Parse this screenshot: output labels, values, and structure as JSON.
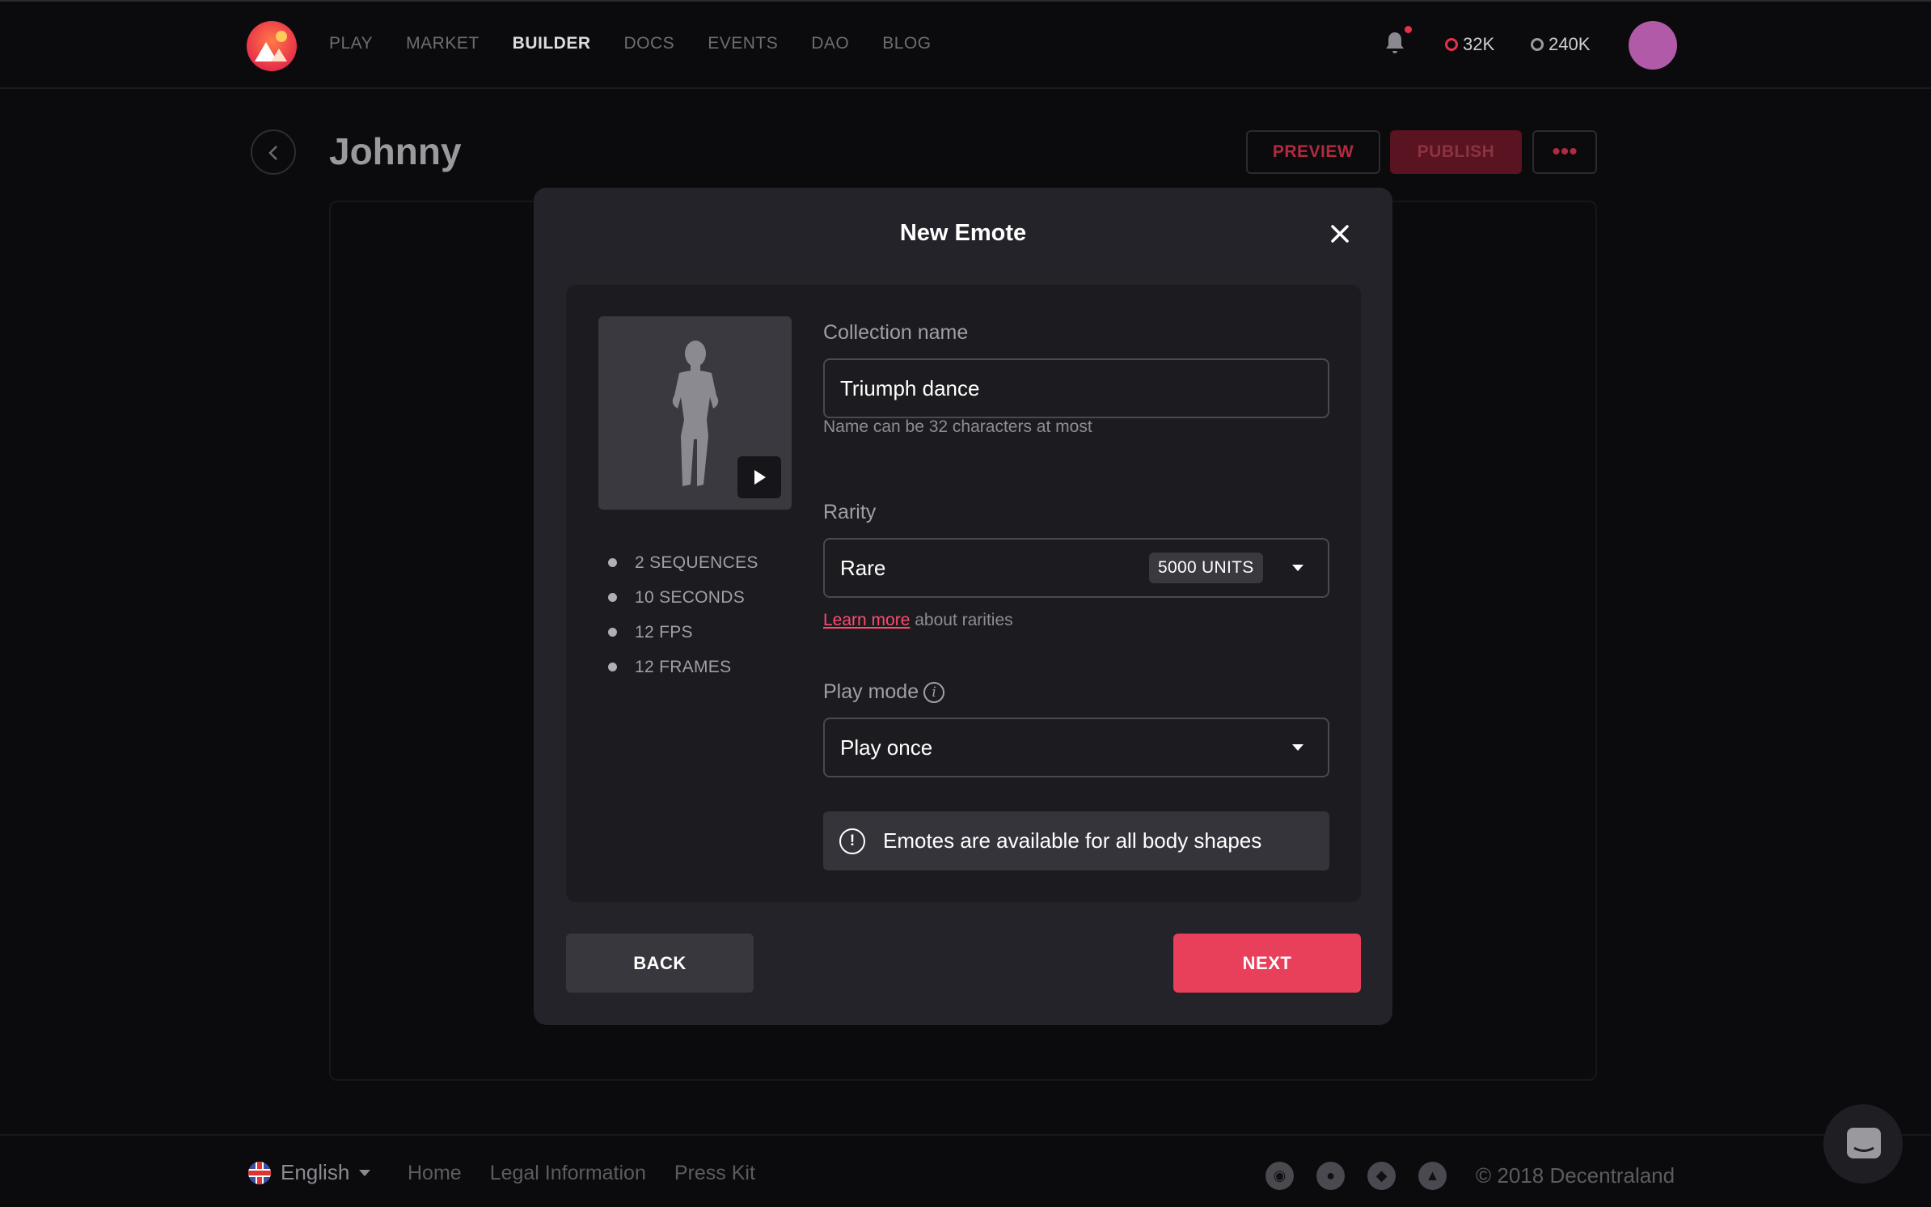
{
  "nav": {
    "items": [
      "PLAY",
      "MARKET",
      "BUILDER",
      "DOCS",
      "EVENTS",
      "DAO",
      "BLOG"
    ],
    "active": "BUILDER"
  },
  "balances": {
    "mana_l2": "32K",
    "mana_l1": "240K"
  },
  "header": {
    "title": "Johnny",
    "preview_label": "PREVIEW",
    "publish_label": "PUBLISH",
    "more_label": "•••"
  },
  "modal": {
    "title": "New Emote",
    "stats": [
      "2 SEQUENCES",
      "10 SECONDS",
      "12 FPS",
      "12 FRAMES"
    ],
    "collection_name_label": "Collection name",
    "collection_name_value": "Triumph dance",
    "collection_name_hint": "Name can be 32 characters at most",
    "rarity_label": "Rarity",
    "rarity_value": "Rare",
    "rarity_units": "5000 UNITS",
    "rarity_hint_link": "Learn more",
    "rarity_hint_text": " about rarities",
    "play_mode_label": "Play mode",
    "play_mode_value": "Play once",
    "notice": "Emotes are available for all body shapes",
    "back_label": "BACK",
    "next_label": "NEXT"
  },
  "footer": {
    "language": "English",
    "links": [
      "Home",
      "Legal Information",
      "Press Kit"
    ],
    "social_icons": [
      "discord-icon",
      "reddit-icon",
      "github-icon",
      "twitter-icon"
    ],
    "copyright": "© 2018 Decentraland"
  },
  "colors": {
    "accent": "#e8405a",
    "background": "#0b0b0d",
    "modal": "#242329"
  }
}
